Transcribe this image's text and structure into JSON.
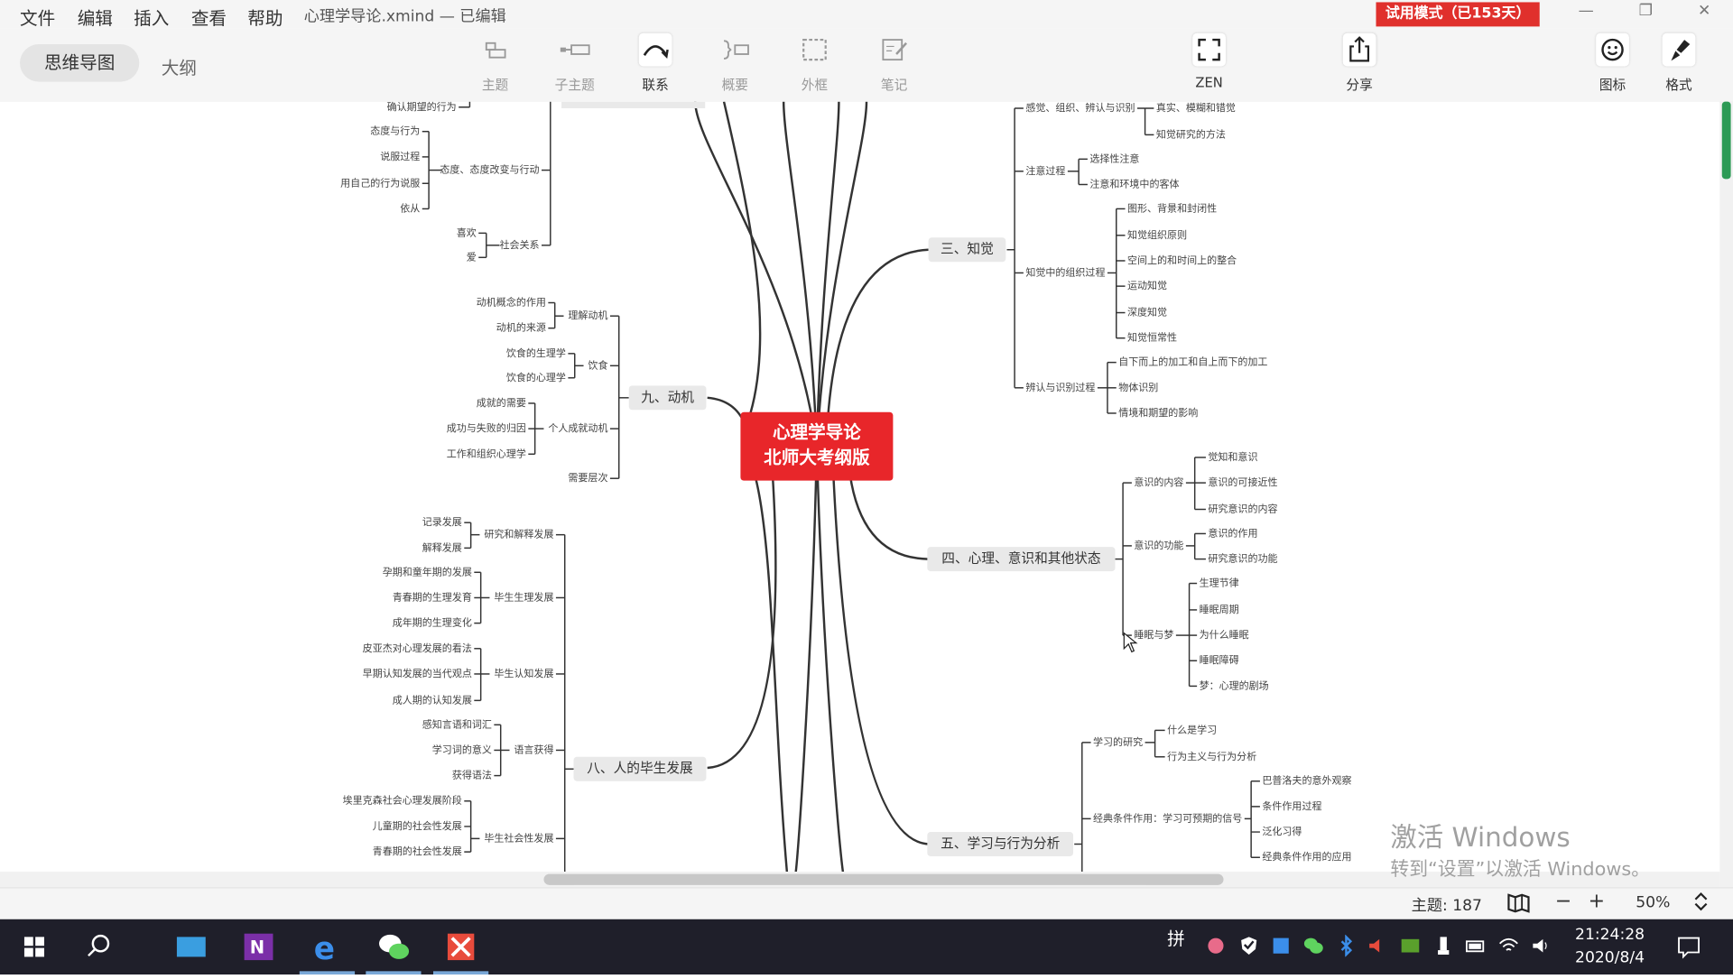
{
  "menubar": {
    "items": [
      "文件",
      "编辑",
      "插入",
      "查看",
      "帮助"
    ],
    "window_title": "心理学导论.xmind — 已编辑",
    "trial_badge": "试用模式（已153天）"
  },
  "toolbar": {
    "view_mindmap": "思维导图",
    "view_outline": "大纲",
    "tools": [
      {
        "label": "主题",
        "icon": "topic-icon"
      },
      {
        "label": "子主题",
        "icon": "subtopic-icon"
      },
      {
        "label": "联系",
        "icon": "relationship-icon"
      },
      {
        "label": "概要",
        "icon": "summary-icon"
      },
      {
        "label": "外框",
        "icon": "boundary-icon"
      },
      {
        "label": "笔记",
        "icon": "note-icon"
      }
    ],
    "zen": "ZEN",
    "share": "分享",
    "icon_panel": "图标",
    "format_panel": "格式"
  },
  "mindmap": {
    "central": {
      "line1": "心理学导论",
      "line2": "北师大考纲版",
      "color": "#e8262a"
    },
    "branches": {
      "b9": "九、动机",
      "b8": "八、人的毕生发展",
      "b3": "三、知觉",
      "b4": "四、心理、意识和其他状态",
      "b5": "五、学习与行为分析"
    },
    "left_top": {
      "leaf_0": "确认期望的行为",
      "g1": "态度、态度改变与行动",
      "g1_children": [
        "态度与行为",
        "说服过程",
        "用自己的行为说服",
        "依从"
      ],
      "g2": "社会关系",
      "g2_children": [
        "喜欢",
        "爱"
      ]
    },
    "b9_groups": [
      {
        "label": "理解动机",
        "children": [
          "动机概念的作用",
          "动机的来源"
        ]
      },
      {
        "label": "饮食",
        "children": [
          "饮食的生理学",
          "饮食的心理学"
        ]
      },
      {
        "label": "个人成就动机",
        "children": [
          "成就的需要",
          "成功与失败的归因",
          "工作和组织心理学"
        ]
      },
      {
        "label": "需要层次",
        "children": []
      }
    ],
    "b8_groups": [
      {
        "label": "研究和解释发展",
        "children": [
          "记录发展",
          "解释发展"
        ]
      },
      {
        "label": "毕生生理发展",
        "children": [
          "孕期和童年期的发展",
          "青春期的生理发育",
          "成年期的生理变化"
        ]
      },
      {
        "label": "毕生认知发展",
        "children": [
          "皮亚杰对心理发展的看法",
          "早期认知发展的当代观点",
          "成人期的认知发展"
        ]
      },
      {
        "label": "语言获得",
        "children": [
          "感知言语和词汇",
          "学习词的意义",
          "获得语法"
        ]
      },
      {
        "label": "毕生社会性发展",
        "children": [
          "埃里克森社会心理发展阶段",
          "儿童期的社会性发展",
          "青春期的社会性发展"
        ]
      }
    ],
    "b3_groups": [
      {
        "label": "感觉、组织、辨认与识别",
        "children": [
          "真实、模糊和错觉",
          "知觉研究的方法"
        ]
      },
      {
        "label": "注意过程",
        "children": [
          "选择性注意",
          "注意和环境中的客体"
        ]
      },
      {
        "label": "知觉中的组织过程",
        "children": [
          "图形、背景和封闭性",
          "知觉组织原则",
          "空间上的和时间上的整合",
          "运动知觉",
          "深度知觉",
          "知觉恒常性"
        ]
      },
      {
        "label": "辨认与识别过程",
        "children": [
          "自下而上的加工和自上而下的加工",
          "物体识别",
          "情境和期望的影响"
        ]
      }
    ],
    "b4_groups": [
      {
        "label": "意识的内容",
        "children": [
          "觉知和意识",
          "意识的可接近性",
          "研究意识的内容"
        ]
      },
      {
        "label": "意识的功能",
        "children": [
          "意识的作用",
          "研究意识的功能"
        ]
      },
      {
        "label": "睡眠与梦",
        "children": [
          "生理节律",
          "睡眠周期",
          "为什么睡眠",
          "睡眠障碍",
          "梦：心理的剧场"
        ]
      }
    ],
    "b5_groups": [
      {
        "label": "学习的研究",
        "children": [
          "什么是学习",
          "行为主义与行为分析"
        ]
      },
      {
        "label": "经典条件作用：学习可预期的信号",
        "children": [
          "巴普洛夫的意外观察",
          "条件作用过程",
          "泛化习得",
          "经典条件作用的应用"
        ]
      }
    ]
  },
  "watermark": {
    "line1": "激活 Windows",
    "line2": "转到“设置”以激活 Windows。"
  },
  "statusbar": {
    "topics": "主题: 187",
    "zoom": "50%"
  },
  "taskbar": {
    "ime": "拼",
    "time": "21:24:28",
    "date": "2020/8/4"
  }
}
